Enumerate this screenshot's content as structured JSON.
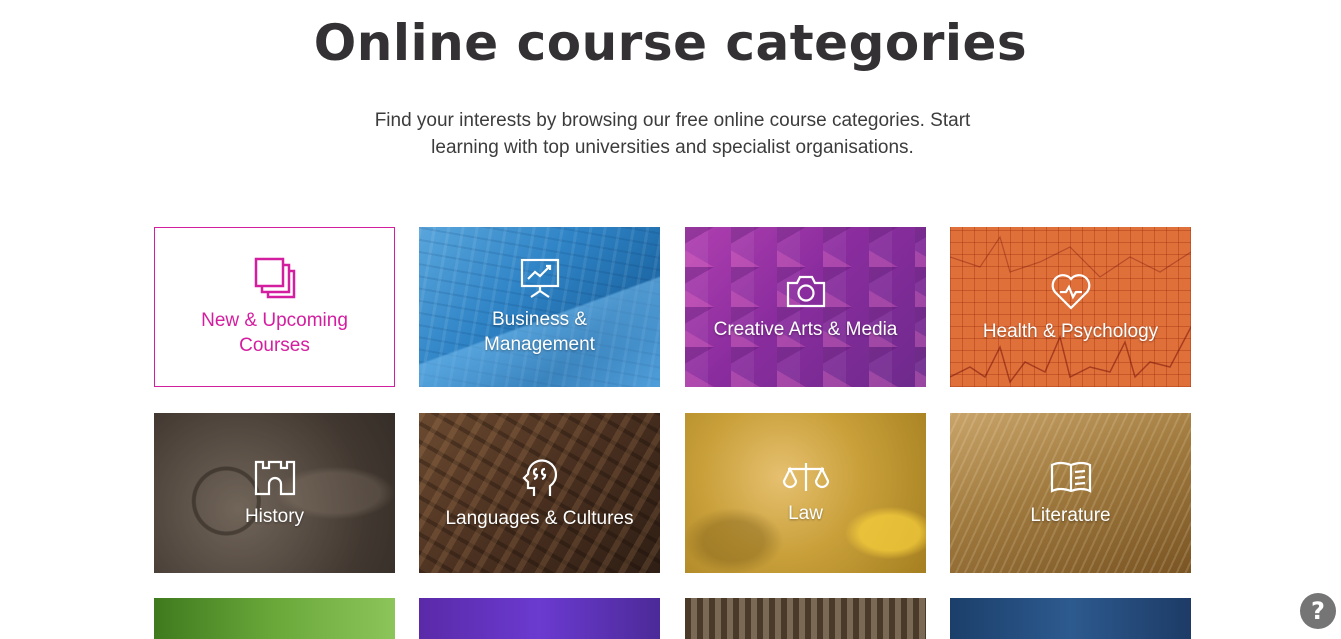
{
  "header": {
    "title": "Online course categories",
    "intro": "Find your interests by browsing our free online course categories. Start learning with top universities and specialist organisations."
  },
  "categories": [
    {
      "label_line1": "New & Upcoming",
      "label_line2": "Courses",
      "icon": "stacked-squares-icon"
    },
    {
      "label_line1": "Business &",
      "label_line2": "Management",
      "icon": "presentation-board-icon"
    },
    {
      "label_line1": "Creative Arts & Media",
      "label_line2": "",
      "icon": "camera-icon"
    },
    {
      "label_line1": "Health & Psychology",
      "label_line2": "",
      "icon": "heart-pulse-icon"
    },
    {
      "label_line1": "History",
      "label_line2": "",
      "icon": "castle-icon"
    },
    {
      "label_line1": "Languages & Cultures",
      "label_line2": "",
      "icon": "speech-head-icon"
    },
    {
      "label_line1": "Law",
      "label_line2": "",
      "icon": "scales-icon"
    },
    {
      "label_line1": "Literature",
      "label_line2": "",
      "icon": "open-book-icon"
    }
  ],
  "help": {
    "label": "?",
    "icon": "help-icon"
  },
  "colors": {
    "accent": "#d41ea0",
    "title": "#333133"
  }
}
